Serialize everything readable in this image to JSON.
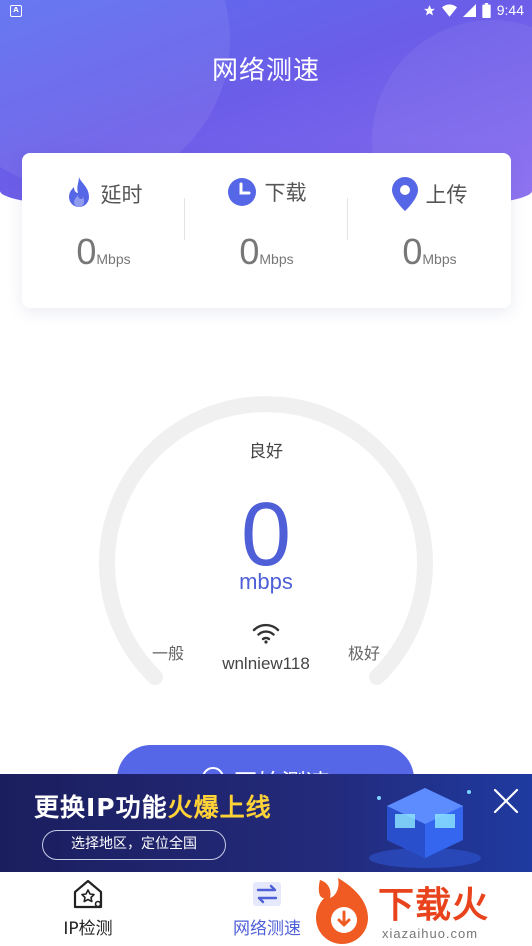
{
  "status_bar": {
    "time": "9:44",
    "app_indicator": "A"
  },
  "header": {
    "title": "网络测速"
  },
  "stats": [
    {
      "icon": "flame-icon",
      "label": "延时",
      "value": "0",
      "unit": "Mbps"
    },
    {
      "icon": "clock-icon",
      "label": "下载",
      "value": "0",
      "unit": "Mbps"
    },
    {
      "icon": "location-pin-icon",
      "label": "上传",
      "value": "0",
      "unit": "Mbps"
    }
  ],
  "gauge": {
    "quality": "良好",
    "speed": "0",
    "unit": "mbps",
    "left_label": "一般",
    "right_label": "极好",
    "ssid": "wnlniew118"
  },
  "start_button": {
    "label": "开始测速"
  },
  "ad": {
    "headline_prefix": "更换IP功能",
    "headline_highlight": "火爆上线",
    "pill": "选择地区，定位全国"
  },
  "bottom_nav": [
    {
      "icon": "house-star-icon",
      "label": "IP检测",
      "active": false
    },
    {
      "icon": "refresh-arrows-icon",
      "label": "网络测速",
      "active": true
    }
  ],
  "watermark": {
    "text": "下载火",
    "sub": "xiazaihuo.com"
  },
  "colors": {
    "accent": "#4e5fd8",
    "header_start": "#5b6ff0",
    "header_end": "#8a6cf0",
    "ad_highlight": "#ffd238",
    "watermark": "#e8431c"
  }
}
